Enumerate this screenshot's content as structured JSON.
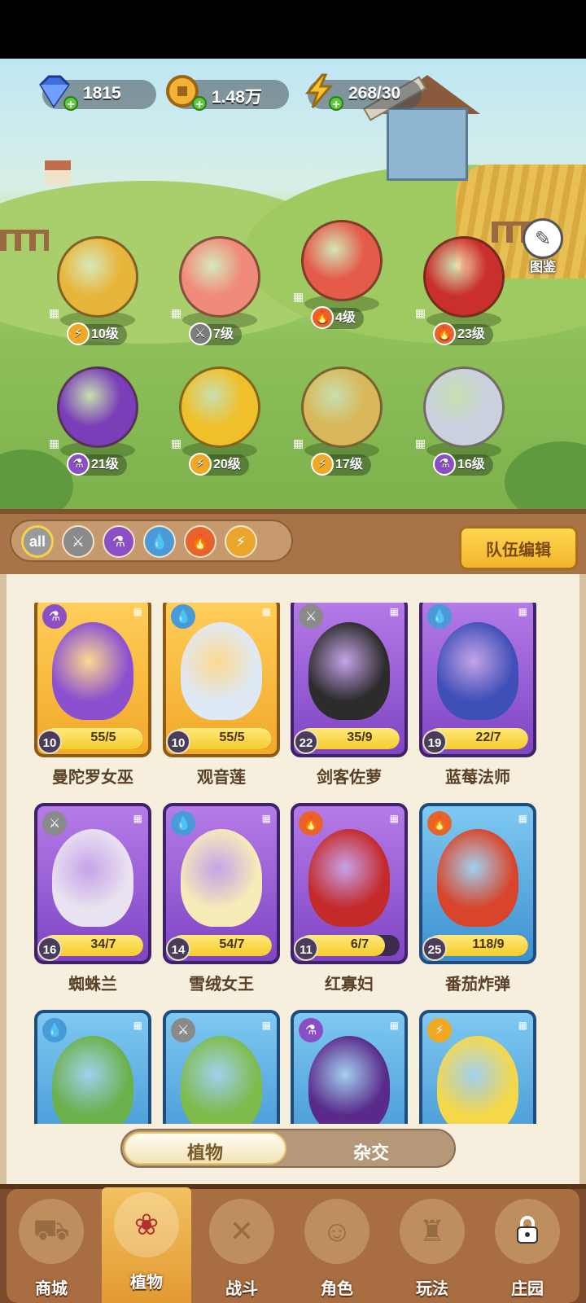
{
  "currencies": [
    {
      "name": "gem",
      "value": "1815",
      "color": "#3d6fe0"
    },
    {
      "name": "coin",
      "value": "1.48万",
      "color": "#f2b233"
    },
    {
      "name": "energy",
      "value": "268/30",
      "color": "#f5c330"
    }
  ],
  "codex": {
    "label": "图鉴"
  },
  "team": [
    {
      "level": "10级",
      "element": "lightning",
      "color": "#e7b53a"
    },
    {
      "level": "7级",
      "element": "sword",
      "color": "#f08a7a"
    },
    {
      "level": "4级",
      "element": "fire",
      "color": "#e45b4a"
    },
    {
      "level": "23级",
      "element": "fire",
      "color": "#c9302c"
    },
    {
      "level": "21级",
      "element": "poison",
      "color": "#7a3fb8"
    },
    {
      "level": "20级",
      "element": "lightning",
      "color": "#f0c02a"
    },
    {
      "level": "17级",
      "element": "lightning",
      "color": "#d8b85a"
    },
    {
      "level": "16级",
      "element": "poison",
      "color": "#c9d0de"
    }
  ],
  "filters": [
    {
      "label": "all",
      "color": "#9a9a9a"
    },
    {
      "label": "sword",
      "color": "#8a8a8a"
    },
    {
      "label": "poison",
      "color": "#8a4fc4"
    },
    {
      "label": "water",
      "color": "#4a9ad8"
    },
    {
      "label": "fire",
      "color": "#e8622c"
    },
    {
      "label": "lightning",
      "color": "#e8a62c"
    }
  ],
  "team_edit_label": "队伍编辑",
  "cards": [
    {
      "name": "曼陀罗女巫",
      "level": "10",
      "progress": "55/5",
      "fill": 1.0,
      "rarity": "gold",
      "element": "poison",
      "art": "#8b4fd0"
    },
    {
      "name": "观音莲",
      "level": "10",
      "progress": "55/5",
      "fill": 1.0,
      "rarity": "gold",
      "element": "water",
      "art": "#dfe9f5"
    },
    {
      "name": "剑客佐萝",
      "level": "22",
      "progress": "35/9",
      "fill": 1.0,
      "rarity": "purple",
      "element": "sword",
      "art": "#2c2c2c"
    },
    {
      "name": "蓝莓法师",
      "level": "19",
      "progress": "22/7",
      "fill": 1.0,
      "rarity": "purple",
      "element": "water",
      "art": "#3f4fb8"
    },
    {
      "name": "蜘蛛兰",
      "level": "16",
      "progress": "34/7",
      "fill": 1.0,
      "rarity": "purple",
      "element": "sword",
      "art": "#e9e2f0"
    },
    {
      "name": "雪绒女王",
      "level": "14",
      "progress": "54/7",
      "fill": 1.0,
      "rarity": "purple",
      "element": "water",
      "art": "#f7ebb8"
    },
    {
      "name": "红寡妇",
      "level": "11",
      "progress": "6/7",
      "fill": 0.857,
      "rarity": "purple",
      "element": "fire",
      "art": "#c42a2a"
    },
    {
      "name": "番茄炸弹",
      "level": "25",
      "progress": "118/9",
      "fill": 1.0,
      "rarity": "blue",
      "element": "fire",
      "art": "#d8452a"
    },
    {
      "name": "",
      "level": "",
      "progress": "",
      "fill": 0,
      "rarity": "blue",
      "element": "water",
      "art": "#6bb04a"
    },
    {
      "name": "",
      "level": "",
      "progress": "",
      "fill": 0,
      "rarity": "blue",
      "element": "sword",
      "art": "#7dbb4a"
    },
    {
      "name": "",
      "level": "",
      "progress": "",
      "fill": 0,
      "rarity": "blue",
      "element": "poison",
      "art": "#5a2a8a"
    },
    {
      "name": "",
      "level": "",
      "progress": "",
      "fill": 0,
      "rarity": "blue",
      "element": "lightning",
      "art": "#f5d84a"
    }
  ],
  "toggle": {
    "active": "植物",
    "inactive": "杂交"
  },
  "nav": [
    {
      "label": "商城",
      "icon": "shop-icon",
      "active": false
    },
    {
      "label": "植物",
      "icon": "plant-icon",
      "active": true
    },
    {
      "label": "战斗",
      "icon": "battle-icon",
      "active": false
    },
    {
      "label": "角色",
      "icon": "character-icon",
      "active": false
    },
    {
      "label": "玩法",
      "icon": "gameplay-icon",
      "active": false
    },
    {
      "label": "庄园",
      "icon": "manor-icon",
      "active": false,
      "locked": true
    }
  ]
}
